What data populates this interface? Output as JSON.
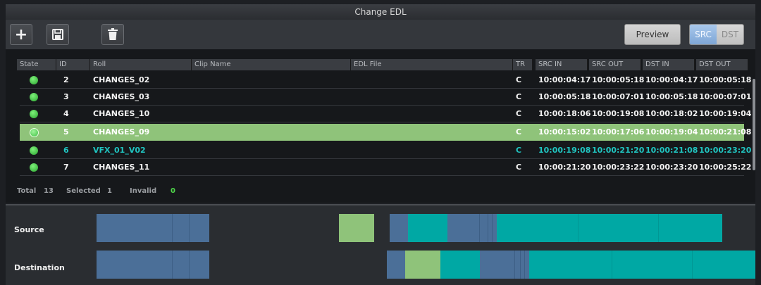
{
  "window": {
    "title": "Change EDL"
  },
  "toolbar": {
    "add_icon": "plus-icon",
    "save_icon": "floppy-disk-icon",
    "delete_icon": "trash-icon",
    "preview_label": "Preview",
    "src_label": "SRC",
    "dst_label": "DST",
    "active_mode": "SRC"
  },
  "table": {
    "columns": {
      "state": "State",
      "id": "ID",
      "roll": "Roll",
      "clip_name": "Clip Name",
      "edl_file": "EDL File",
      "tr": "TR",
      "src_in": "SRC IN",
      "src_out": "SRC OUT",
      "dst_in": "DST IN",
      "dst_out": "DST OUT"
    },
    "rows": [
      {
        "id": "2",
        "roll": "CHANGES_02",
        "clip_name": "",
        "edl_file": "",
        "tr": "C",
        "src_in": "10:00:04:17",
        "src_out": "10:00:05:18",
        "dst_in": "10:00:04:17",
        "dst_out": "10:00:05:18"
      },
      {
        "id": "3",
        "roll": "CHANGES_03",
        "clip_name": "",
        "edl_file": "",
        "tr": "C",
        "src_in": "10:00:05:18",
        "src_out": "10:00:07:01",
        "dst_in": "10:00:05:18",
        "dst_out": "10:00:07:01"
      },
      {
        "id": "4",
        "roll": "CHANGES_10",
        "clip_name": "",
        "edl_file": "",
        "tr": "C",
        "src_in": "10:00:18:06",
        "src_out": "10:00:19:08",
        "dst_in": "10:00:18:02",
        "dst_out": "10:00:19:04"
      },
      {
        "id": "5",
        "roll": "CHANGES_09",
        "clip_name": "",
        "edl_file": "",
        "tr": "C",
        "src_in": "10:00:15:02",
        "src_out": "10:00:17:06",
        "dst_in": "10:00:19:04",
        "dst_out": "10:00:21:08"
      },
      {
        "id": "6",
        "roll": "VFX_01_V02",
        "clip_name": "",
        "edl_file": "",
        "tr": "C",
        "src_in": "10:00:19:08",
        "src_out": "10:00:21:20",
        "dst_in": "10:00:21:08",
        "dst_out": "10:00:23:20"
      },
      {
        "id": "7",
        "roll": "CHANGES_11",
        "clip_name": "",
        "edl_file": "",
        "tr": "C",
        "src_in": "10:00:21:20",
        "src_out": "10:00:23:22",
        "dst_in": "10:00:23:20",
        "dst_out": "10:00:25:22"
      }
    ],
    "selected_row": "5",
    "vfx_row": "6"
  },
  "footer": {
    "total_label": "Total",
    "total_value": "13",
    "selected_label": "Selected",
    "selected_value": "1",
    "invalid_label": "Invalid",
    "invalid_value": "0"
  },
  "timeline": {
    "source_label": "Source",
    "destination_label": "Destination"
  },
  "colors": {
    "selected_row": "#8fc37a",
    "vfx_text": "#20c4c0",
    "clip_blue": "#4b6f98",
    "clip_teal": "#00a8a4",
    "clip_green": "#8fc37a",
    "state_dot": "#3fbf44"
  }
}
